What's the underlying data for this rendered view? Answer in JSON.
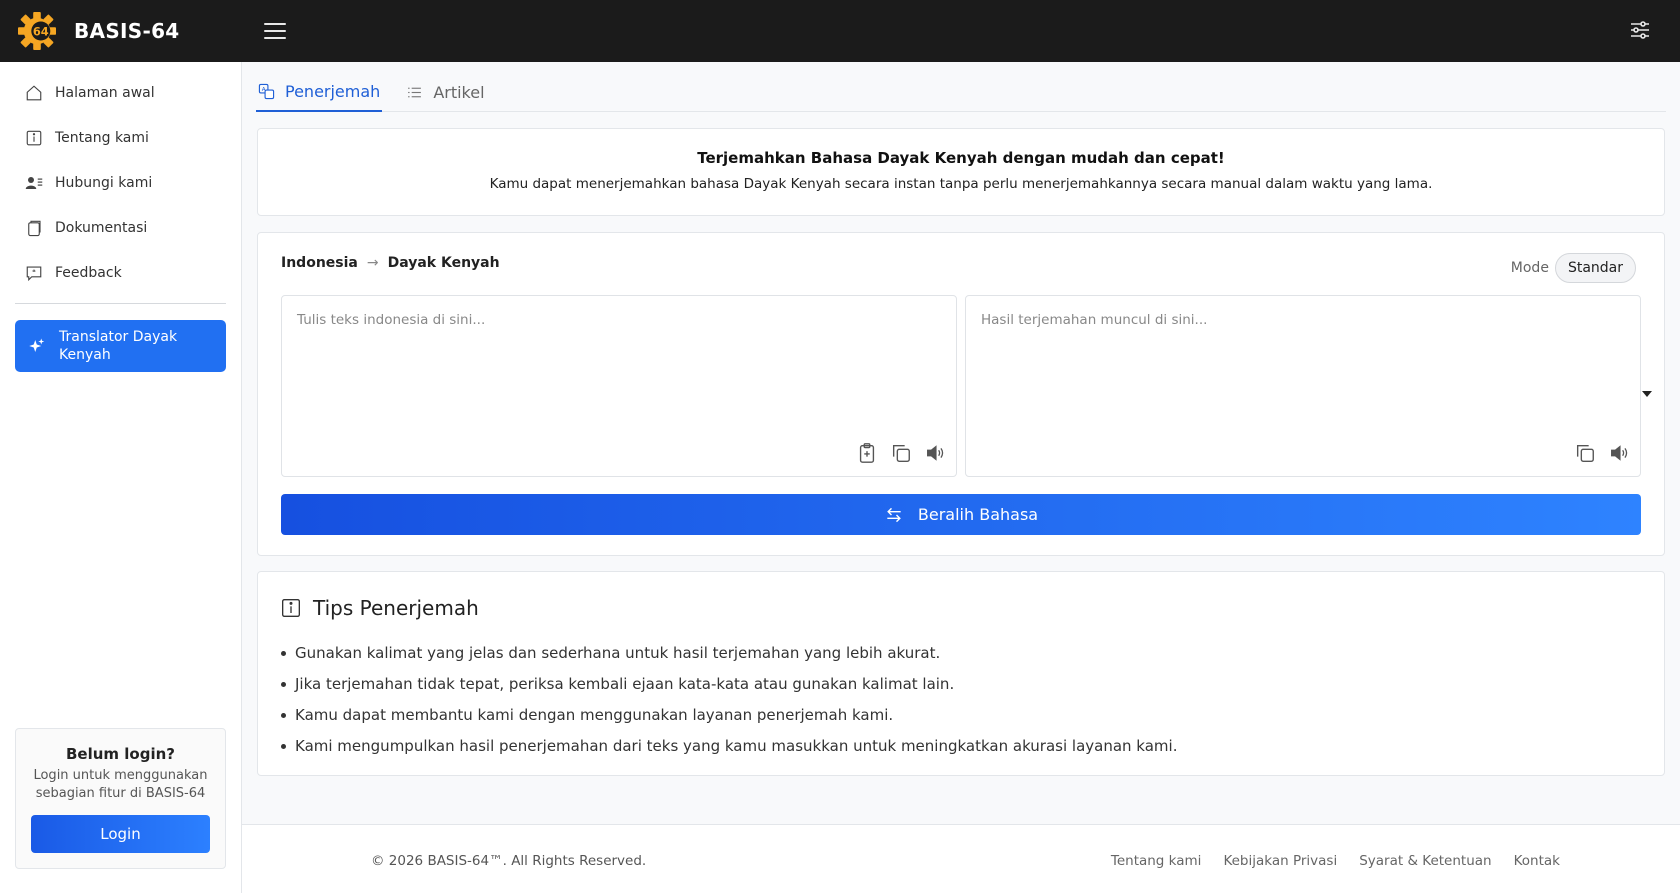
{
  "app": {
    "brand": "BASIS-64",
    "logo_text": "64",
    "logo_color": "#f5a623"
  },
  "sidebar": {
    "items": [
      {
        "label": "Halaman awal",
        "icon": "home-icon"
      },
      {
        "label": "Tentang kami",
        "icon": "info-icon"
      },
      {
        "label": "Hubungi kami",
        "icon": "contact-icon"
      },
      {
        "label": "Dokumentasi",
        "icon": "docs-icon"
      },
      {
        "label": "Feedback",
        "icon": "feedback-icon"
      }
    ],
    "active": {
      "label": "Translator Dayak Kenyah",
      "icon": "sparkles-icon"
    },
    "login": {
      "title": "Belum login?",
      "subtitle": "Login untuk menggunakan sebagian fitur di BASIS-64",
      "button": "Login"
    }
  },
  "tabs": [
    {
      "label": "Penerjemah",
      "icon": "translate-icon",
      "active": true
    },
    {
      "label": "Artikel",
      "icon": "list-icon",
      "active": false
    }
  ],
  "hero": {
    "title": "Terjemahkan Bahasa Dayak Kenyah dengan mudah dan cepat!",
    "description": "Kamu dapat menerjemahkan bahasa Dayak Kenyah secara instan tanpa perlu menerjemahkannya secara manual dalam waktu yang lama."
  },
  "translator": {
    "source_lang": "Indonesia",
    "target_lang": "Dayak Kenyah",
    "mode_label": "Mode",
    "mode_value": "Standar",
    "input_value": "",
    "input_placeholder": "Tulis teks indonesia di sini...",
    "output_placeholder": "Hasil terjemahan muncul di sini...",
    "switch_button": "Beralih Bahasa"
  },
  "tips": {
    "title": "Tips Penerjemah",
    "items": [
      "Gunakan kalimat yang jelas dan sederhana untuk hasil terjemahan yang lebih akurat.",
      "Jika terjemahan tidak tepat, periksa kembali ejaan kata-kata atau gunakan kalimat lain.",
      "Kamu dapat membantu kami dengan menggunakan layanan penerjemah kami.",
      "Kami mengumpulkan hasil penerjemahan dari teks yang kamu masukkan untuk meningkatkan akurasi layanan kami."
    ]
  },
  "footer": {
    "copyright": "© 2026 BASIS-64™. All Rights Reserved.",
    "links": [
      "Tentang kami",
      "Kebijakan Privasi",
      "Syarat & Ketentuan",
      "Kontak"
    ]
  },
  "colors": {
    "primary": "#2170f2",
    "topbar": "#1b1b1b",
    "tab_active": "#1f5fd6"
  }
}
